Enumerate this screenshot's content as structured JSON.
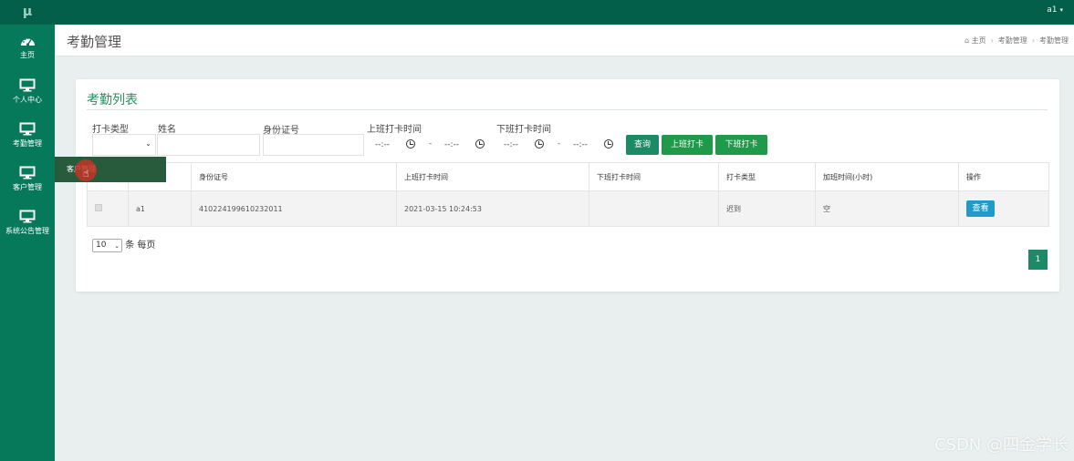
{
  "topbar": {
    "logo": "μ",
    "user": "a1",
    "caret": "▾"
  },
  "sidebar": {
    "items": [
      {
        "label": "主页",
        "icon": "dashboard-icon"
      },
      {
        "label": "个人中心",
        "icon": "monitor-icon"
      },
      {
        "label": "考勤管理",
        "icon": "monitor-icon"
      },
      {
        "label": "客户管理",
        "icon": "monitor-icon"
      },
      {
        "label": "系统公告管理",
        "icon": "monitor-icon"
      }
    ],
    "hover_flyout": "客户管理"
  },
  "header": {
    "title": "考勤管理",
    "breadcrumb": [
      "主页",
      "考勤管理",
      "考勤管理"
    ]
  },
  "panel": {
    "title": "考勤列表",
    "filters": {
      "type_label": "打卡类型",
      "name_label": "姓名",
      "id_label": "身份证号",
      "on_label": "上班打卡时间",
      "off_label": "下班打卡时间",
      "time_placeholder": "--:--",
      "range_sep": "-"
    },
    "buttons": {
      "search": "查询",
      "clock_in": "上班打卡",
      "clock_out": "下班打卡"
    },
    "table": {
      "columns": [
        "",
        "",
        "身份证号",
        "上班打卡时间",
        "下班打卡时间",
        "打卡类型",
        "加班时间(小时)",
        "操作"
      ],
      "rows": [
        {
          "name": "a1",
          "id_number": "410224199610232011",
          "clock_in": "2021-03-15 10:24:53",
          "clock_out": "",
          "type": "迟到",
          "overtime": "空",
          "action": "查看"
        }
      ]
    },
    "pagination": {
      "page_size": "10",
      "per_page_suffix": "条 每页",
      "current_page": "1"
    }
  },
  "watermark": "CSDN @四金学长",
  "colors": {
    "topbar": "#035e4a",
    "sidebar": "#07795b",
    "accent": "#1d8a66",
    "title_green": "#2e8b63",
    "view_button": "#1e9cc7"
  }
}
